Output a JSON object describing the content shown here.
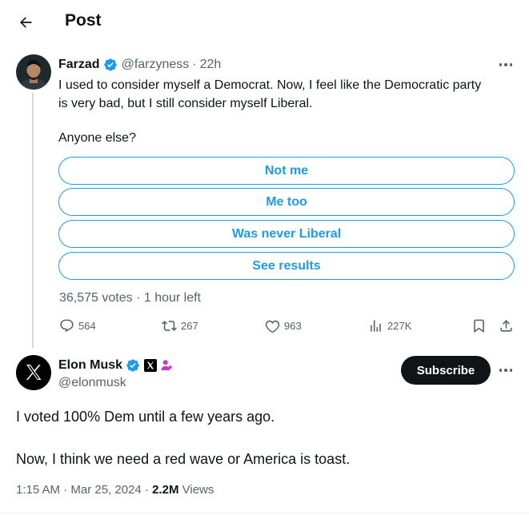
{
  "header": {
    "title": "Post"
  },
  "quoted": {
    "name": "Farzad",
    "handle": "@farzyness",
    "time_sep": "·",
    "time": "22h",
    "text_line1": "I used to consider myself a Democrat. Now, I feel like the Democratic party",
    "text_line2": "is very bad, but I still consider myself Liberal.",
    "question": "Anyone else?",
    "poll_options": [
      "Not me",
      "Me too",
      "Was never Liberal",
      "See results"
    ],
    "poll_meta": "36,575 votes · 1 hour left",
    "stats": {
      "replies": "564",
      "reposts": "267",
      "likes": "963",
      "views": "227K"
    }
  },
  "main": {
    "name": "Elon Musk",
    "handle": "@elonmusk",
    "subscribe_label": "Subscribe",
    "text_line1": "I voted 100% Dem until a few years ago.",
    "text_line2": "Now, I think we need a red wave or America is toast.",
    "time": "1:15 AM · Mar 25, 2024 · ",
    "views_count": "2.2M",
    "views_label": "Views"
  },
  "colors": {
    "accent": "#1d9bf0",
    "text": "#0f1419",
    "muted": "#536471",
    "button": "#0f1419"
  },
  "icons": [
    "back-arrow-icon",
    "verified-badge-icon",
    "more-icon",
    "reply-icon",
    "repost-icon",
    "like-icon",
    "views-icon",
    "bookmark-icon",
    "share-icon",
    "x-logo-icon",
    "org-badge-icon"
  ]
}
